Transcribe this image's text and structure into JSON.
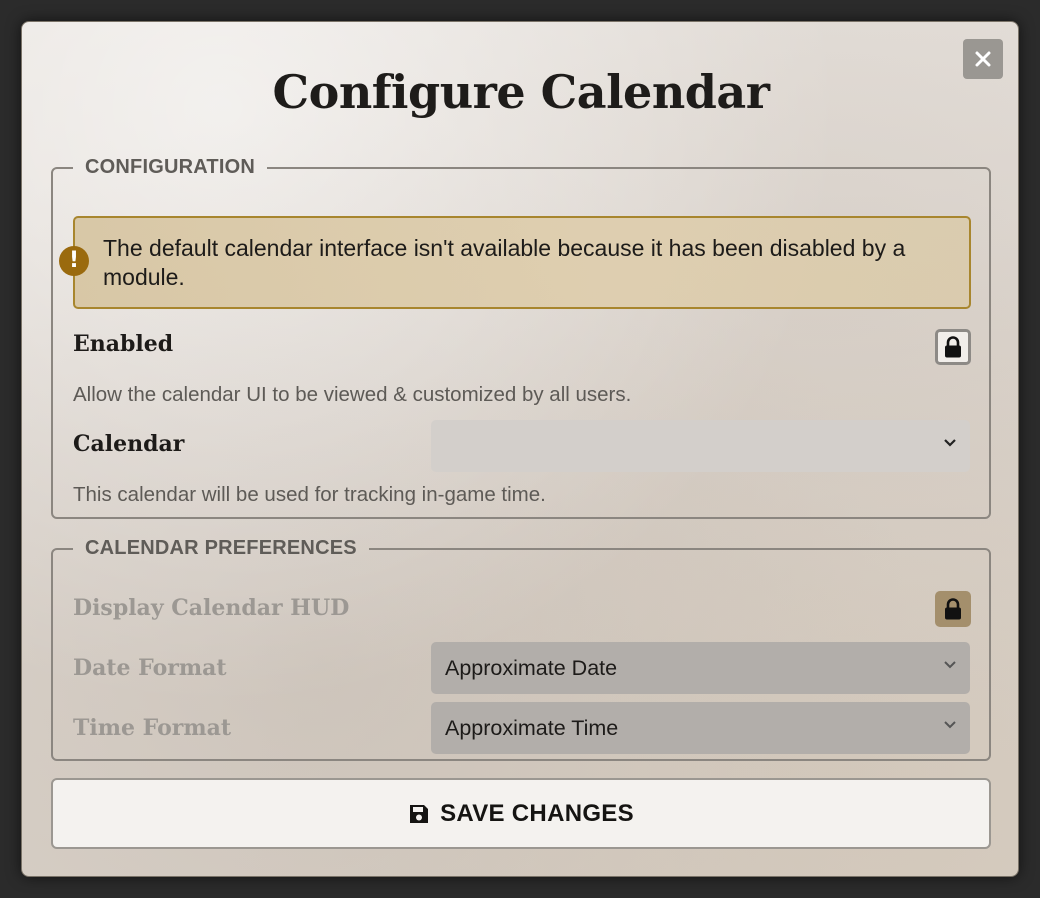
{
  "dialog": {
    "title": "Configure Calendar",
    "close_icon": "close-icon"
  },
  "configuration": {
    "legend": "CONFIGURATION",
    "warning": {
      "icon": "exclamation-icon",
      "text": "The default calendar interface isn't available because it has been disabled by a module."
    },
    "enabled": {
      "label": "Enabled",
      "hint": "Allow the calendar UI to be viewed & customized by all users.",
      "icon": "lock-icon"
    },
    "calendar": {
      "label": "Calendar",
      "value": "",
      "hint": "This calendar will be used for tracking in-game time."
    }
  },
  "preferences": {
    "legend": "CALENDAR PREFERENCES",
    "display_hud": {
      "label": "Display Calendar HUD",
      "icon": "lock-icon"
    },
    "date_format": {
      "label": "Date Format",
      "value": "Approximate Date"
    },
    "time_format": {
      "label": "Time Format",
      "value": "Approximate Time"
    }
  },
  "save": {
    "label": "SAVE CHANGES",
    "icon": "floppy-disk-icon"
  },
  "colors": {
    "warning_border": "#a8862e",
    "warning_icon": "#9a6a0e",
    "lock_active_bg": "#a48f6c"
  }
}
